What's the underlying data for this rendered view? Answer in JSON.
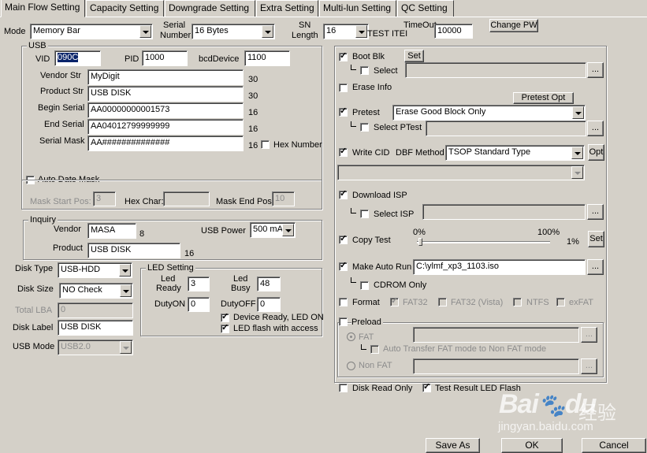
{
  "tabs": [
    "Main Flow Setting",
    "Capacity Setting",
    "Downgrade Setting",
    "Extra Setting",
    "Multi-lun Setting",
    "QC Setting"
  ],
  "header": {
    "mode_label": "Mode",
    "mode_value": "Memory Bar",
    "serial_label_1": "Serial",
    "serial_label_2": "Number",
    "serial_value": "16 Bytes",
    "sn_label_1": "SN",
    "sn_label_2": "Length",
    "sn_value": "16",
    "test_item_label": "TEST ITEI",
    "timeout_label": "TimeOut",
    "timeout_value": "10000",
    "change_pw": "Change PW"
  },
  "usb": {
    "title": "USB",
    "vid_label": "VID",
    "vid_value": "090C",
    "pid_label": "PID",
    "pid_value": "1000",
    "bcd_label": "bcdDevice",
    "bcd_value": "1100",
    "vendor_label": "Vendor Str",
    "vendor_value": "MyDigit",
    "vendor_len": "30",
    "product_label": "Product Str",
    "product_value": "USB DISK",
    "product_len": "30",
    "begin_label": "Begin Serial",
    "begin_value": "AA00000000001573",
    "begin_len": "16",
    "end_label": "End Serial",
    "end_value": "AA04012799999999",
    "end_len": "16",
    "mask_label": "Serial Mask",
    "mask_value": "AA##############",
    "mask_len": "16",
    "hex_number": "Hex Number",
    "auto_date_mask": "Auto Date Mask",
    "mask_start_label": "Mask Start Pos:",
    "mask_start_value": "3",
    "hex_char_label": "Hex Char:",
    "hex_char_value": "",
    "mask_end_label": "Mask End Pos:",
    "mask_end_value": "10"
  },
  "inquiry": {
    "title": "Inquiry",
    "vendor_label": "Vendor",
    "vendor_value": "MASA",
    "vendor_len": "8",
    "usb_power_label": "USB Power",
    "usb_power_value": "500 mA",
    "product_label": "Product",
    "product_value": "USB DISK",
    "product_len": "16"
  },
  "disk": {
    "type_label": "Disk Type",
    "type_value": "USB-HDD",
    "size_label": "Disk Size",
    "size_value": "NO Check",
    "lba_label": "Total LBA",
    "lba_value": "0",
    "label_label": "Disk Label",
    "label_value": "USB DISK",
    "mode_label": "USB Mode",
    "mode_value": "USB2.0"
  },
  "led": {
    "title": "LED Setting",
    "ready_label_1": "Led",
    "ready_label_2": "Ready",
    "ready_value": "3",
    "busy_label_1": "Led",
    "busy_label_2": "Busy",
    "busy_value": "48",
    "dutyon_label": "DutyON",
    "dutyon_value": "0",
    "dutyoff_label": "DutyOFF",
    "dutyoff_value": "0",
    "device_ready": "Device Ready, LED ON",
    "led_flash": "LED flash with access"
  },
  "right": {
    "boot_blk": "Boot Blk",
    "set": "Set",
    "select": "Select",
    "browse": "...",
    "erase_info": "Erase Info",
    "pretest_opt": "Pretest Opt",
    "pretest": "Pretest",
    "pretest_value": "Erase Good Block Only",
    "select_ptest": "Select PTest",
    "write_cid": "Write CID",
    "dbf_method": "DBF Method",
    "dbf_value": "TSOP Standard Type",
    "opt": "Opt",
    "download_isp": "Download ISP",
    "select_isp": "Select ISP",
    "copy_test": "Copy Test",
    "pct_0": "0%",
    "pct_100": "100%",
    "pct_value": "1%",
    "copy_progress": 0.01,
    "make_auto_run": "Make Auto Run",
    "auto_run_path": "C:\\ylmf_xp3_1103.iso",
    "cdrom_only": "CDROM Only",
    "format": "Format",
    "fat32": "FAT32",
    "fat32_vista": "FAT32 (Vista)",
    "ntfs": "NTFS",
    "exfat": "exFAT",
    "preload": "Preload",
    "fat": "FAT",
    "auto_transfer": "Auto Transfer FAT mode to Non FAT mode",
    "non_fat": "Non FAT",
    "disk_read_only": "Disk Read Only",
    "test_result_led": "Test Result LED Flash"
  },
  "footer": {
    "save_as": "Save  As",
    "ok": "OK",
    "cancel": "Cancel"
  },
  "watermark": {
    "brand": "Bai",
    "brand2": "du",
    "cn": "经验",
    "url": "jingyan.baidu.com"
  }
}
